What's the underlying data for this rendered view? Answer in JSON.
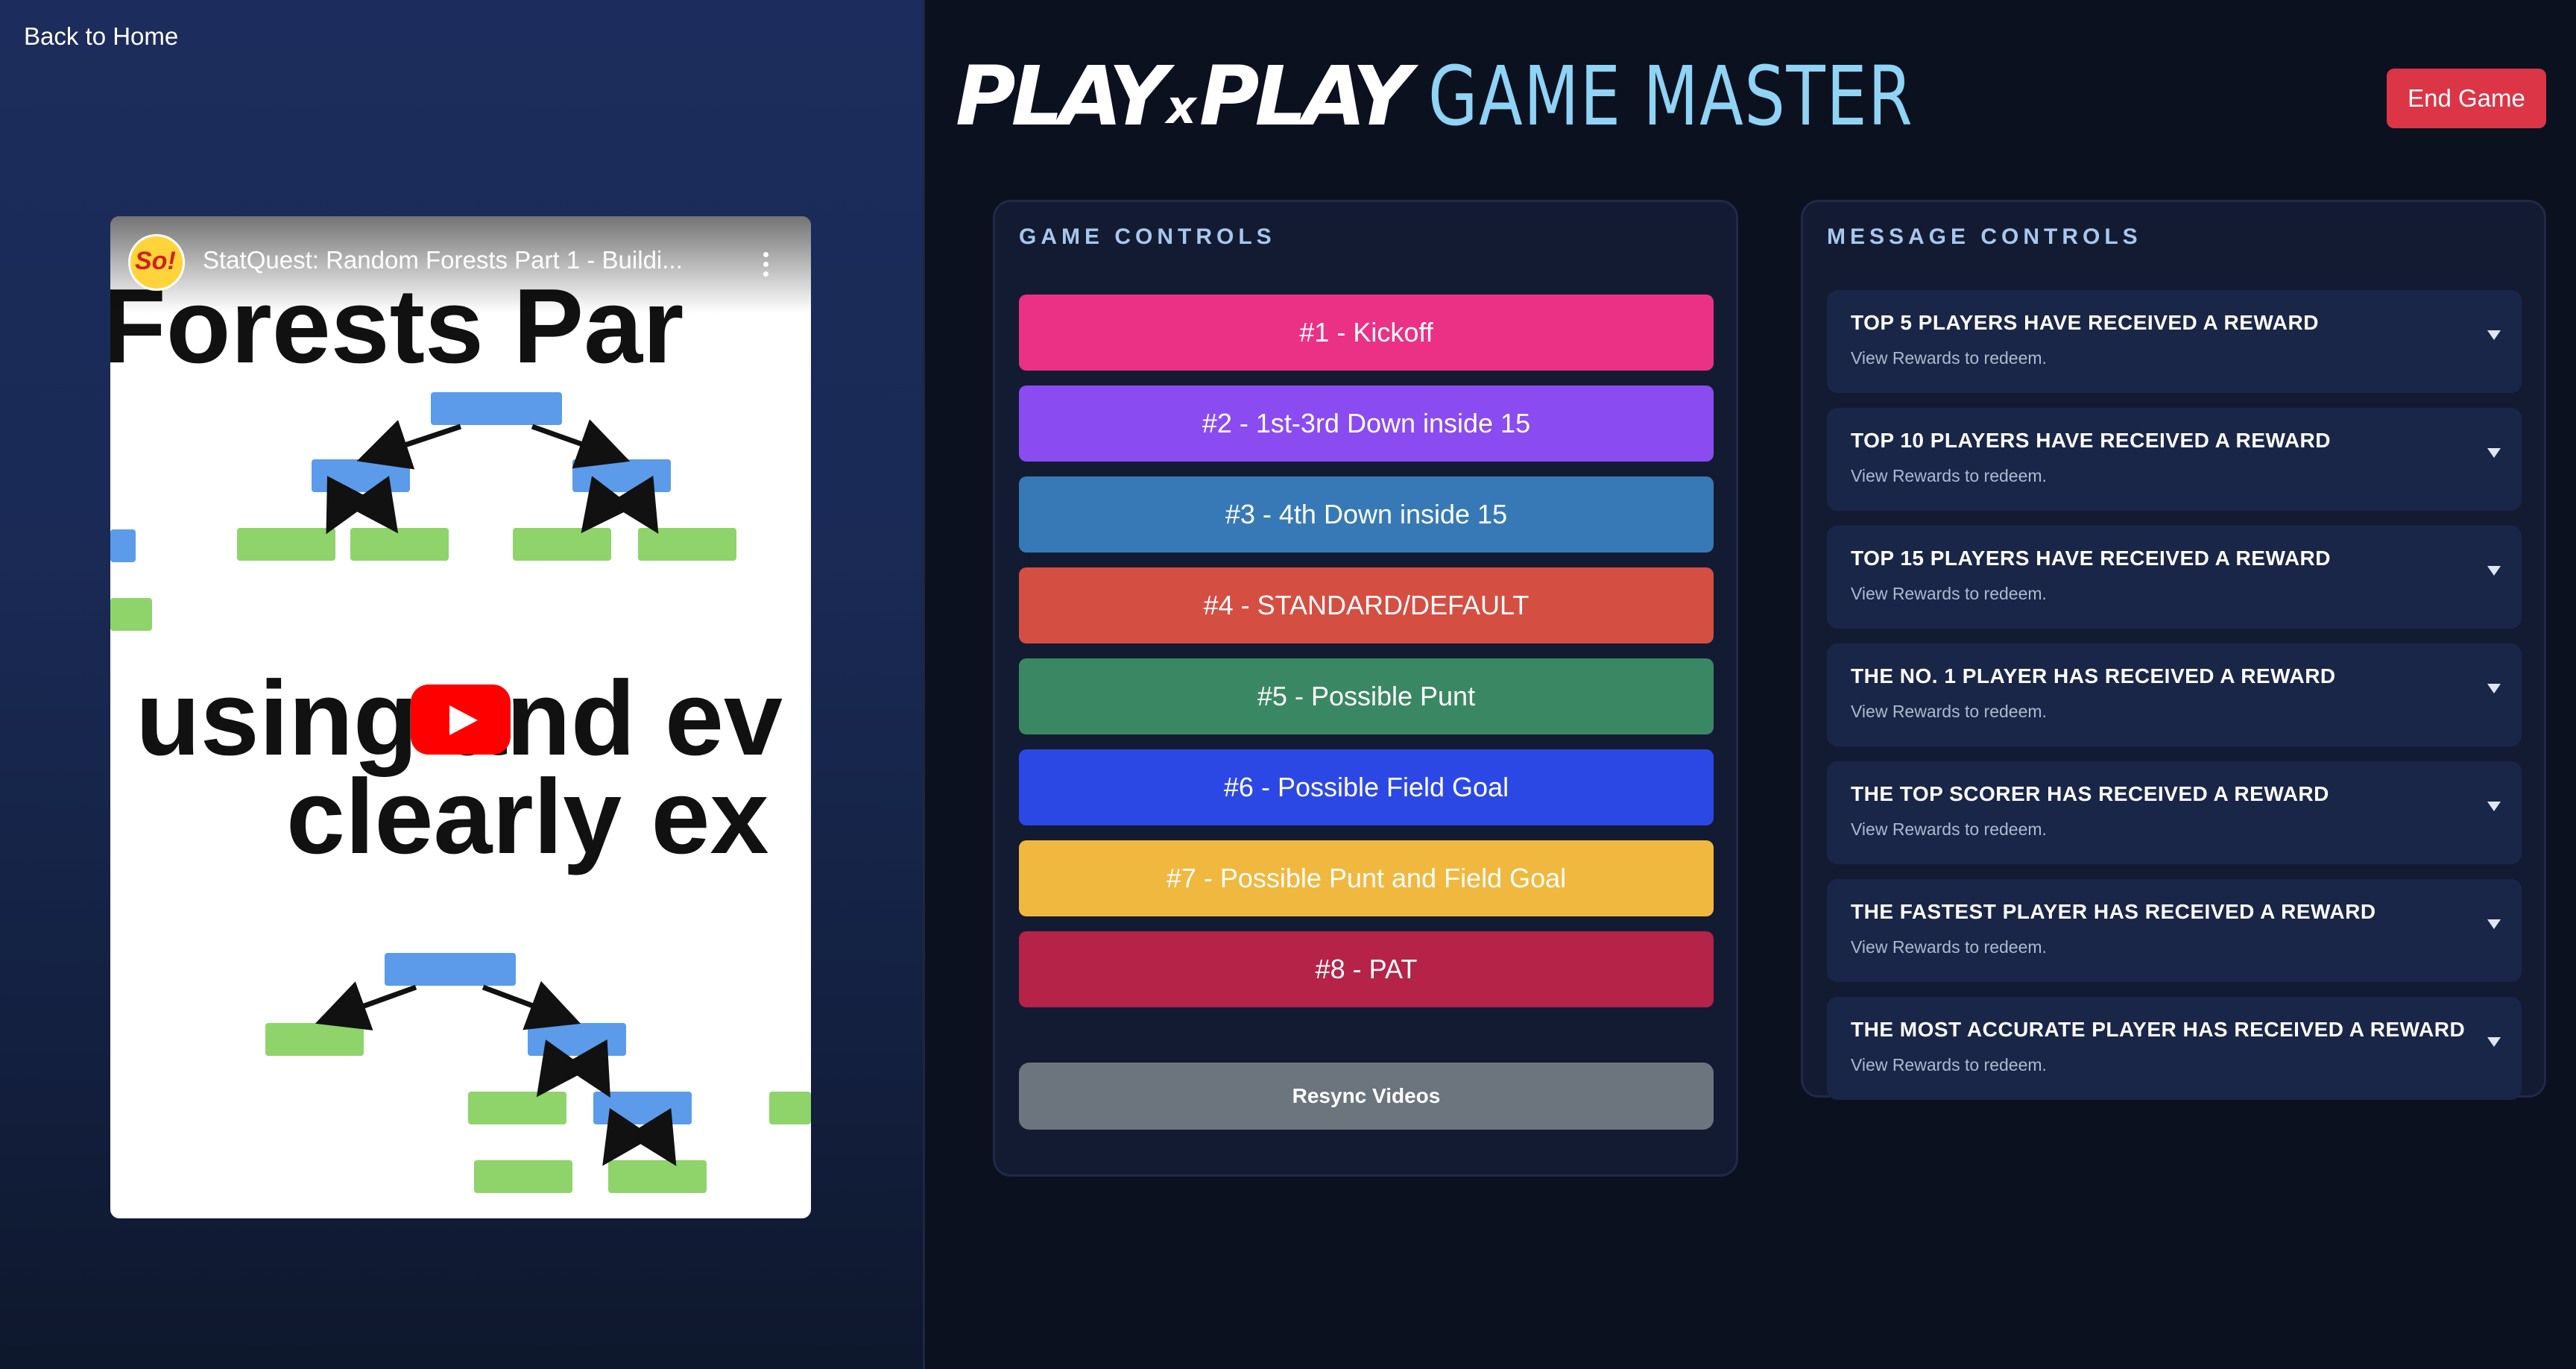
{
  "nav": {
    "back_label": "Back to Home"
  },
  "header": {
    "brand_play": "PLAY",
    "brand_x": "x",
    "brand_play2": "PLAY",
    "brand_rest": "GAME MASTER",
    "end_game_label": "End Game"
  },
  "video": {
    "title": "StatQuest: Random Forests Part 1 - Buildi...",
    "avatar_text": "So!",
    "slide_lines": [
      "Forests Par",
      "using and ev",
      "clearly ex"
    ],
    "colors": {
      "node_blue": "#5b9bea",
      "leaf_green": "#8ed46a"
    }
  },
  "game_controls": {
    "title": "GAME CONTROLS",
    "buttons": [
      {
        "label": "#1 - Kickoff",
        "color": "#ea3185"
      },
      {
        "label": "#2 - 1st-3rd Down inside 15",
        "color": "#8a4bf0"
      },
      {
        "label": "#3 - 4th Down inside 15",
        "color": "#3779b6"
      },
      {
        "label": "#4 - STANDARD/DEFAULT",
        "color": "#d54e42"
      },
      {
        "label": "#5 - Possible Punt",
        "color": "#3a8863"
      },
      {
        "label": "#6 - Possible Field Goal",
        "color": "#2c48e4"
      },
      {
        "label": "#7 - Possible Punt and Field Goal",
        "color": "#f1b83f"
      },
      {
        "label": "#8 - PAT",
        "color": "#b52348"
      }
    ],
    "resync_label": "Resync Videos"
  },
  "message_controls": {
    "title": "MESSAGE CONTROLS",
    "items": [
      {
        "title": "TOP 5 PLAYERS HAVE RECEIVED A REWARD",
        "subtitle": "View Rewards to redeem."
      },
      {
        "title": "TOP 10 PLAYERS HAVE RECEIVED A REWARD",
        "subtitle": "View Rewards to redeem."
      },
      {
        "title": "TOP 15 PLAYERS HAVE RECEIVED A REWARD",
        "subtitle": "View Rewards to redeem."
      },
      {
        "title": "THE NO. 1 PLAYER HAS RECEIVED A REWARD",
        "subtitle": "View Rewards to redeem."
      },
      {
        "title": "THE TOP SCORER HAS RECEIVED A REWARD",
        "subtitle": "View Rewards to redeem."
      },
      {
        "title": "THE FASTEST PLAYER HAS RECEIVED A REWARD",
        "subtitle": "View Rewards to redeem."
      },
      {
        "title": "THE MOST ACCURATE PLAYER HAS RECEIVED A REWARD",
        "subtitle": "View Rewards to redeem."
      }
    ]
  }
}
